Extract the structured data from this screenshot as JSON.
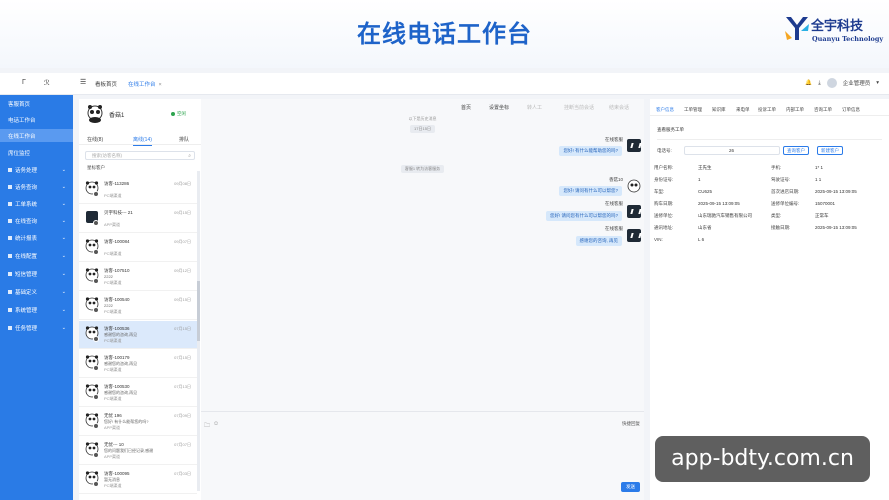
{
  "banner": {
    "title": "在线电话工作台",
    "logo_cn": "全宇科技",
    "logo_en": "Quanyu Technology"
  },
  "topbar": {
    "icons": [
      "Γ",
      "ℛ"
    ],
    "tabs": [
      {
        "label": "看板首页"
      },
      {
        "label": "在线工作台",
        "close": "×"
      }
    ],
    "user": "企业管理员",
    "user_caret": "▾"
  },
  "sidebar": {
    "items": [
      {
        "label": "客服首页"
      },
      {
        "label": "电话工作台"
      },
      {
        "label": "在线工作台"
      },
      {
        "label": "席位监控"
      },
      {
        "label": "话务处理"
      },
      {
        "label": "话务查询"
      },
      {
        "label": "工单系统"
      },
      {
        "label": "在线查询"
      },
      {
        "label": "统计报表"
      },
      {
        "label": "在线配置"
      },
      {
        "label": "短信管理"
      },
      {
        "label": "基础定义"
      },
      {
        "label": "系统管理"
      },
      {
        "label": "任务管理"
      }
    ]
  },
  "contacts": {
    "agent_name": "香菇1",
    "status": "空闲",
    "tabs": [
      "在线(8)",
      "离线(14)",
      "排队"
    ],
    "search_placeholder": "搜索(访客名称)",
    "filter_label": "星标客户",
    "list": [
      {
        "name": "访客-113286",
        "time": "09月08日",
        "msg": "",
        "src": "PC端渠道"
      },
      {
        "name": "贝宇科技---          21",
        "time": "09月15日",
        "msg": "",
        "src": "APP渠道"
      },
      {
        "name": "访客-100084",
        "time": "09月07日",
        "msg": "",
        "src": "PC端渠道"
      },
      {
        "name": "访客-107510",
        "time": "09月12日",
        "msg": "2222",
        "src": "PC端渠道"
      },
      {
        "name": "访客-100540",
        "time": "09月15日",
        "msg": "2222",
        "src": "PC端渠道"
      },
      {
        "name": "访客-100536",
        "time": "07月15日",
        "msg": "感谢您的咨询,再见",
        "src": "PC端渠道"
      },
      {
        "name": "访客-100179",
        "time": "07月15日",
        "msg": "感谢您的咨询,再见",
        "src": "PC端渠道"
      },
      {
        "name": "访客-100530",
        "time": "07月13日",
        "msg": "感谢您的咨询,再见",
        "src": "PC端渠道"
      },
      {
        "name": "无忧          196",
        "time": "07月09日",
        "msg": "您好! 有什么能帮您的吗?",
        "src": "APP渠道"
      },
      {
        "name": "无忧---            10",
        "time": "07月07日",
        "msg": "您的问题我们已经记录,感谢",
        "src": "APP渠道"
      },
      {
        "name": "访客-100095",
        "time": "07月03日",
        "msg": "暂无消息",
        "src": "PC端渠道"
      }
    ]
  },
  "chat": {
    "tools": [
      "首页",
      "设置坐标",
      "转人工",
      "挂断当前会话",
      "结束会话"
    ],
    "sys_top": "以下是历史消息",
    "date_pill": "17日15日",
    "transfer_note": "客服1 转为访客服务",
    "messages": [
      {
        "sender": "在线客服",
        "text": "您好! 有什么能帮助您的吗?",
        "avatar": "bot"
      },
      {
        "sender": "香菇10",
        "text": "您好! 请问有什么可以帮您?",
        "avatar": "user"
      },
      {
        "sender": "在线客服",
        "text": "您好! 请问您有什么可以帮您的吗?",
        "avatar": "bot"
      },
      {
        "sender": "在线客服",
        "text": "感谢您的咨询, 再见",
        "avatar": "bot"
      }
    ],
    "shortcut": "快捷回复",
    "send": "发送"
  },
  "customer": {
    "tabs": [
      "客户信息",
      "工单管理",
      "知识库",
      "来电单",
      "投诉工单",
      "内部工单",
      "咨询工单",
      "订单信息"
    ],
    "section_title": "查看服务工单",
    "phone_label": "电话号:",
    "phone_value": "26",
    "btn_query": "查询客户",
    "btn_new": "新建客户",
    "fields": [
      {
        "label": "用户名称:",
        "value": "王先生",
        "label2": "手机:",
        "value2": "1*          1"
      },
      {
        "label": "身份证号:",
        "value": "1",
        "label2": "驾驶证号:",
        "value2": "1          1"
      },
      {
        "label": "车型:",
        "value": "CU625",
        "label2": "首次进店日期:",
        "value2": "2025-09-15 13:09:05"
      },
      {
        "label": "购车日期:",
        "value": "2025-09-15 13:09:05",
        "label2": "送修单位编号:",
        "value2": "15070001"
      },
      {
        "label": "送修单位:",
        "value": "山东瑞驰汽车销售有限公司",
        "label2": "类型:",
        "value2": "正常车"
      },
      {
        "label": "通讯地址:",
        "value": "山东省",
        "label2": "接触日期:",
        "value2": "2025-09-15 13:09:05"
      },
      {
        "label": "VIN:",
        "value": "L          6",
        "label2": "",
        "value2": ""
      }
    ]
  },
  "watermark": "app-bdty.com.cn"
}
